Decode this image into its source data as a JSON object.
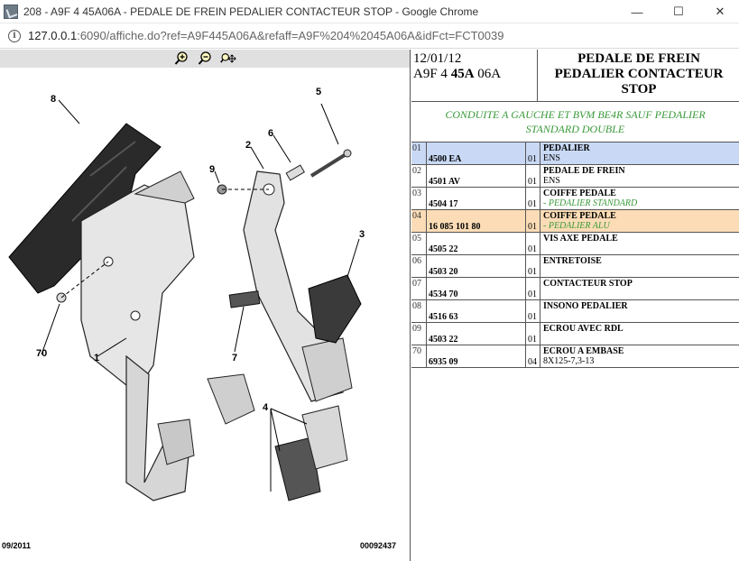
{
  "window": {
    "title": "208 - A9F 4 45A06A - PEDALE DE FREIN PEDALIER CONTACTEUR STOP - Google Chrome",
    "minimize": "—",
    "maximize": "☐",
    "close": "✕"
  },
  "address": {
    "host": "127.0.0.1",
    "path": ":6090/affiche.do?ref=A9F445A06A&refaff=A9F%204%2045A06A&idFct=FCT0039"
  },
  "toolbar": {
    "icons": [
      "zoom-in-icon",
      "zoom-out-icon",
      "zoom-move-icon"
    ]
  },
  "diagram": {
    "callouts": [
      "8",
      "5",
      "6",
      "2",
      "9",
      "3",
      "70",
      "1",
      "7",
      "4"
    ],
    "footer_left": "09/2011",
    "footer_right": "00092437"
  },
  "header": {
    "date": "12/01/12",
    "code_prefix": "A9F 4 ",
    "code_bold": "45A",
    "code_suffix": " 06A",
    "title_line1": "PEDALE DE FREIN",
    "title_line2": "PEDALIER CONTACTEUR",
    "title_line3": "STOP"
  },
  "condition": {
    "line1": "CONDUITE A GAUCHE ET BVM BE4R SAUF PEDALIER",
    "line2": "STANDARD DOUBLE"
  },
  "parts": [
    {
      "idx": "01",
      "ref": "4500 EA",
      "qty": "01",
      "name": "PEDALIER",
      "note": "ENS",
      "note_green": false,
      "highlight": "blue"
    },
    {
      "idx": "02",
      "ref": "4501 AV",
      "qty": "01",
      "name": "PEDALE DE FREIN",
      "note": "ENS",
      "note_green": false,
      "highlight": ""
    },
    {
      "idx": "03",
      "ref": "4504 17",
      "qty": "01",
      "name": "COIFFE PEDALE",
      "note": "- PEDALIER STANDARD",
      "note_green": true,
      "highlight": ""
    },
    {
      "idx": "04",
      "ref": "16 085 101 80",
      "qty": "01",
      "name": "COIFFE PEDALE",
      "note": "- PEDALIER ALU",
      "note_green": true,
      "highlight": "orange"
    },
    {
      "idx": "05",
      "ref": "4505 22",
      "qty": "01",
      "name": "VIS AXE PEDALE",
      "note": "",
      "note_green": false,
      "highlight": ""
    },
    {
      "idx": "06",
      "ref": "4503 20",
      "qty": "01",
      "name": "ENTRETOISE",
      "note": "",
      "note_green": false,
      "highlight": ""
    },
    {
      "idx": "07",
      "ref": "4534 70",
      "qty": "01",
      "name": "CONTACTEUR STOP",
      "note": "",
      "note_green": false,
      "highlight": ""
    },
    {
      "idx": "08",
      "ref": "4516 63",
      "qty": "01",
      "name": "INSONO PEDALIER",
      "note": "",
      "note_green": false,
      "highlight": ""
    },
    {
      "idx": "09",
      "ref": "4503 22",
      "qty": "01",
      "name": "ECROU AVEC RDL",
      "note": "",
      "note_green": false,
      "highlight": ""
    },
    {
      "idx": "70",
      "ref": "6935 09",
      "qty": "04",
      "name": "ECROU A EMBASE",
      "note": "8X125-7,3-13",
      "note_green": false,
      "highlight": ""
    }
  ],
  "colors": {
    "blue_highlight": "#c9d9f5",
    "orange_highlight": "#fbdcb6",
    "green_text": "#3a9a3a"
  }
}
